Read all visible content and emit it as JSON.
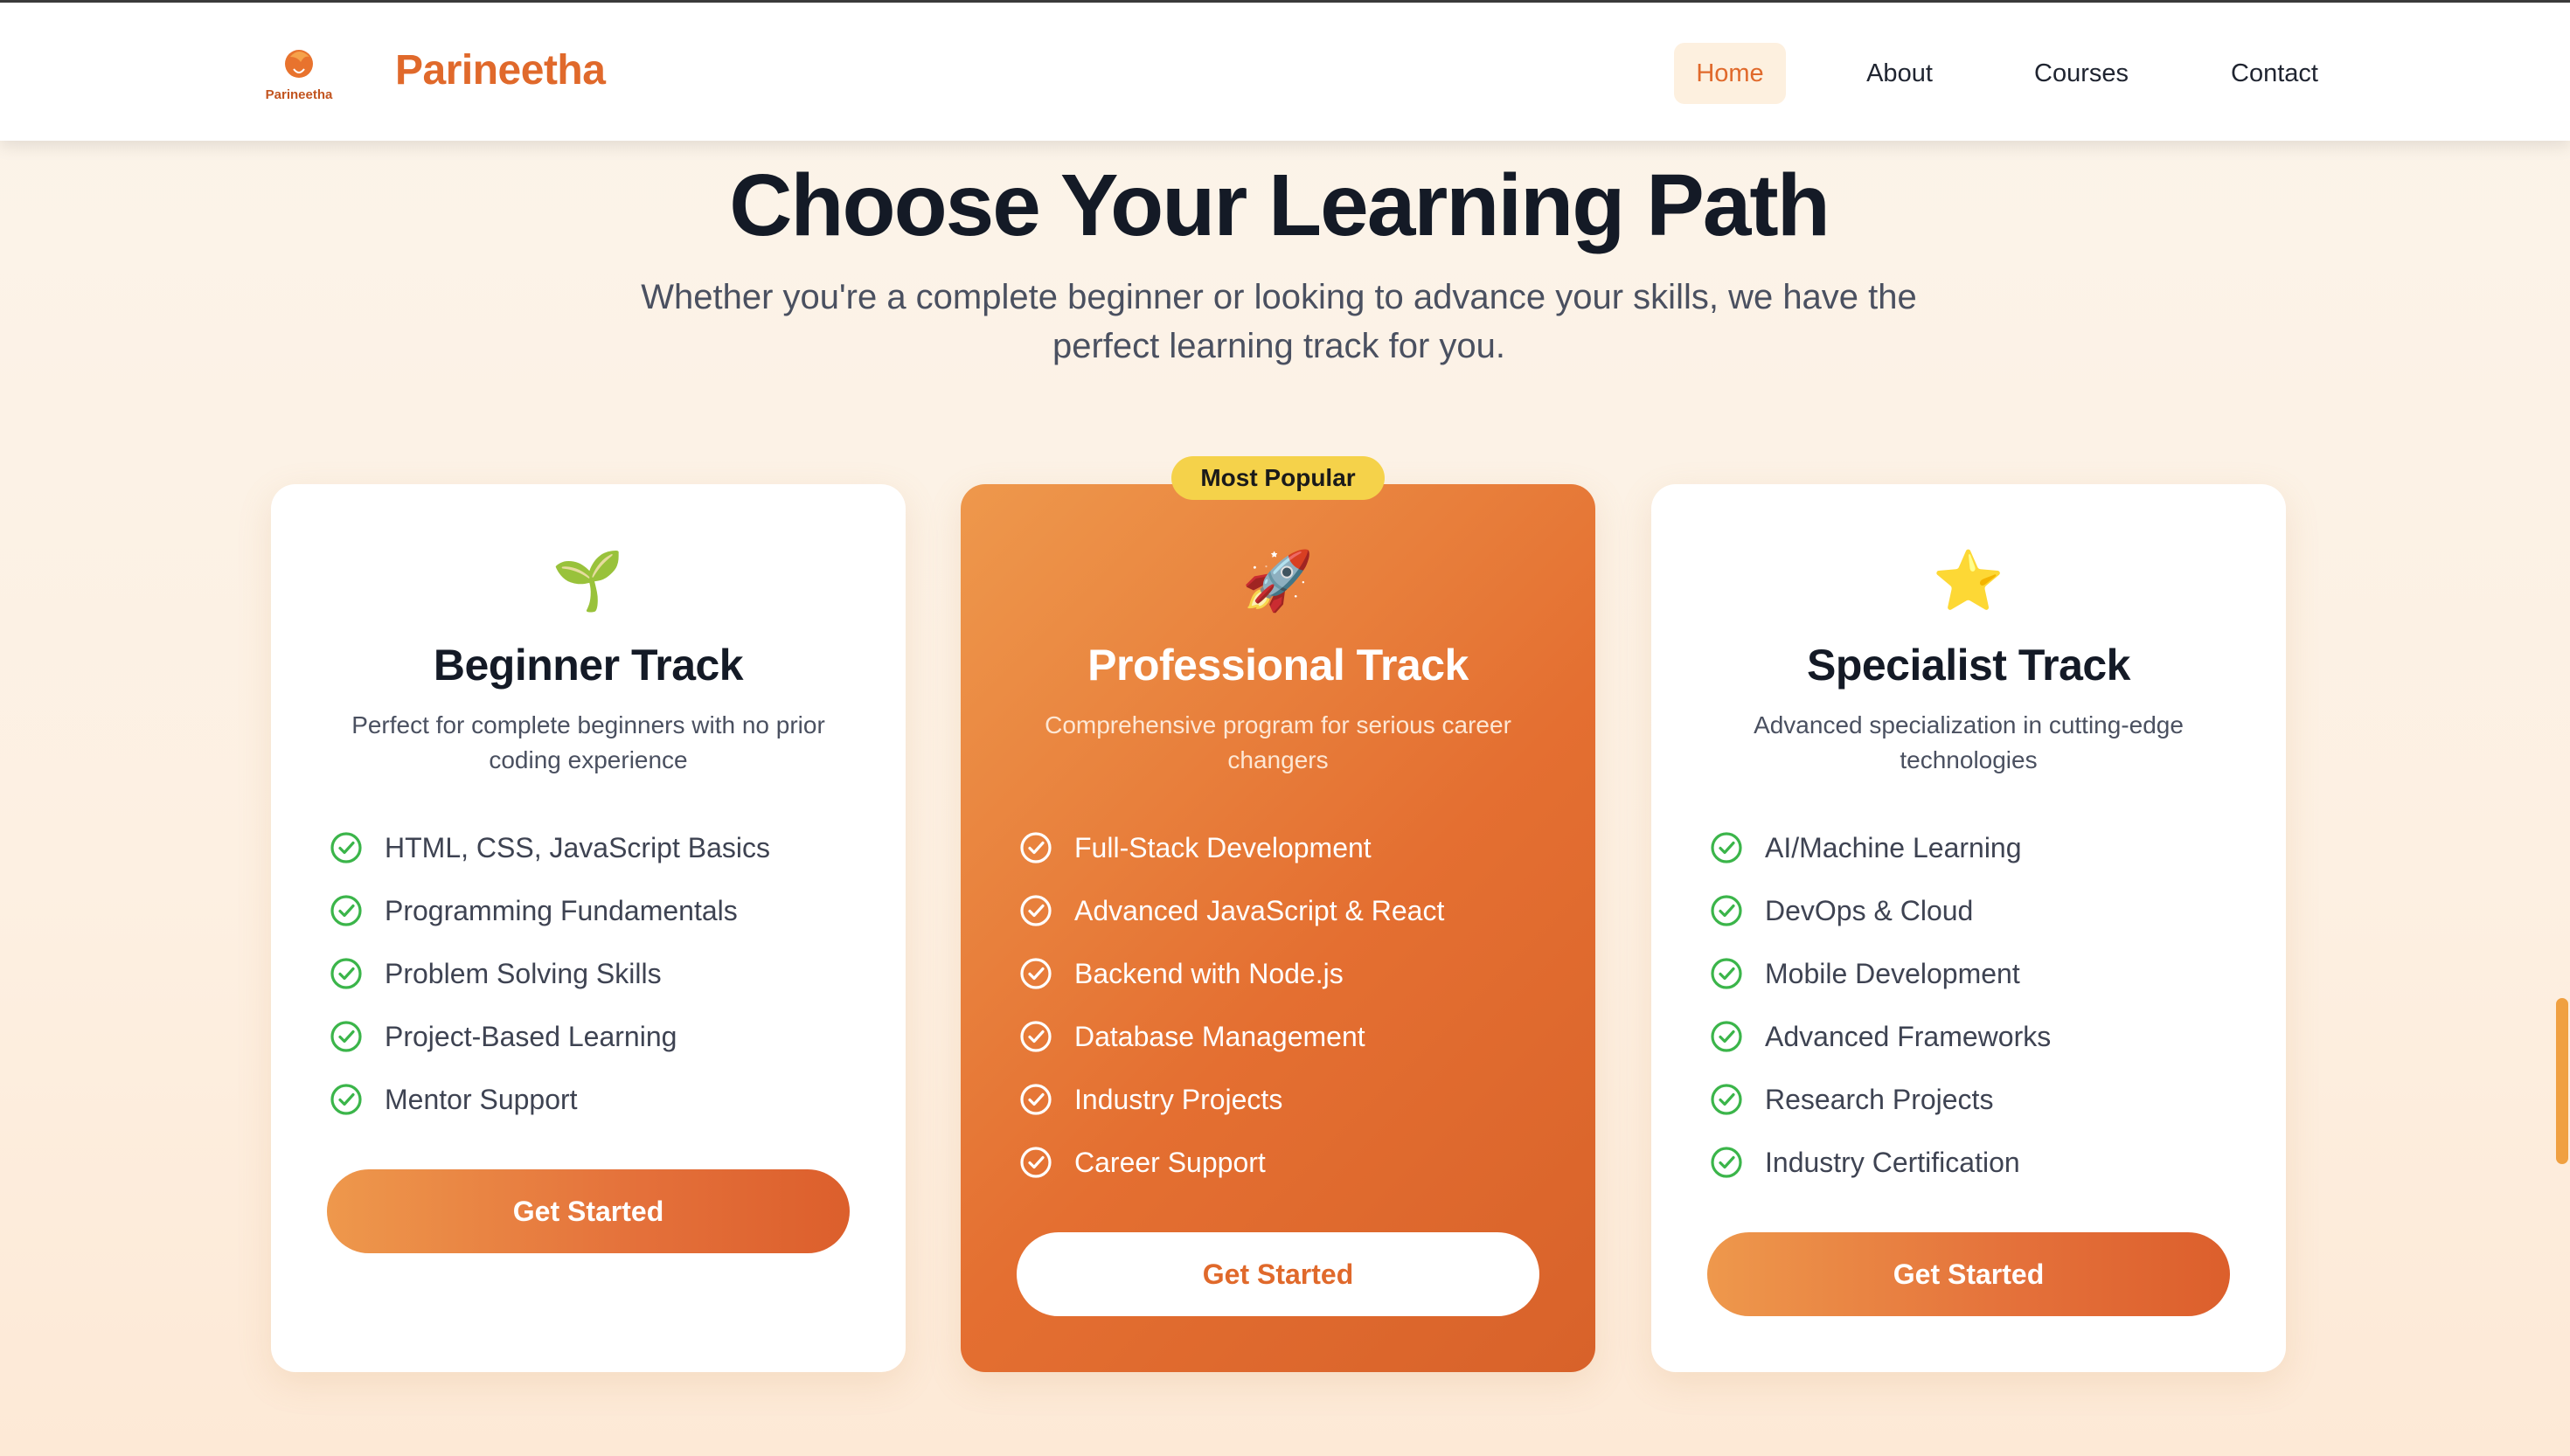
{
  "nav": {
    "logo_text": "Parineetha",
    "brand": "Parineetha",
    "links": [
      {
        "label": "Home",
        "active": true
      },
      {
        "label": "About",
        "active": false
      },
      {
        "label": "Courses",
        "active": false
      },
      {
        "label": "Contact",
        "active": false
      }
    ]
  },
  "hero": {
    "title": "Choose Your Learning Path",
    "subtitle": "Whether you're a complete beginner or looking to advance your skills, we have the perfect learning track for you."
  },
  "tracks": [
    {
      "icon": "seedling-icon",
      "icon_glyph": "🌱",
      "title": "Beginner Track",
      "description": "Perfect for complete beginners with no prior coding experience",
      "features": [
        "HTML, CSS, JavaScript Basics",
        "Programming Fundamentals",
        "Problem Solving Skills",
        "Project-Based Learning",
        "Mentor Support"
      ],
      "cta": "Get Started"
    },
    {
      "badge": "Most Popular",
      "icon": "rocket-icon",
      "icon_glyph": "🚀",
      "title": "Professional Track",
      "description": "Comprehensive program for serious career changers",
      "features": [
        "Full-Stack Development",
        "Advanced JavaScript & React",
        "Backend with Node.js",
        "Database Management",
        "Industry Projects",
        "Career Support"
      ],
      "cta": "Get Started"
    },
    {
      "icon": "star-icon",
      "icon_glyph": "⭐",
      "title": "Specialist Track",
      "description": "Advanced specialization in cutting-edge technologies",
      "features": [
        "AI/Machine Learning",
        "DevOps & Cloud",
        "Mobile Development",
        "Advanced Frameworks",
        "Research Projects",
        "Industry Certification"
      ],
      "cta": "Get Started"
    }
  ],
  "colors": {
    "accent": "#e0692b",
    "badge": "#f5d24a",
    "check_green": "#3bb54a",
    "text_dark": "#141a26"
  }
}
